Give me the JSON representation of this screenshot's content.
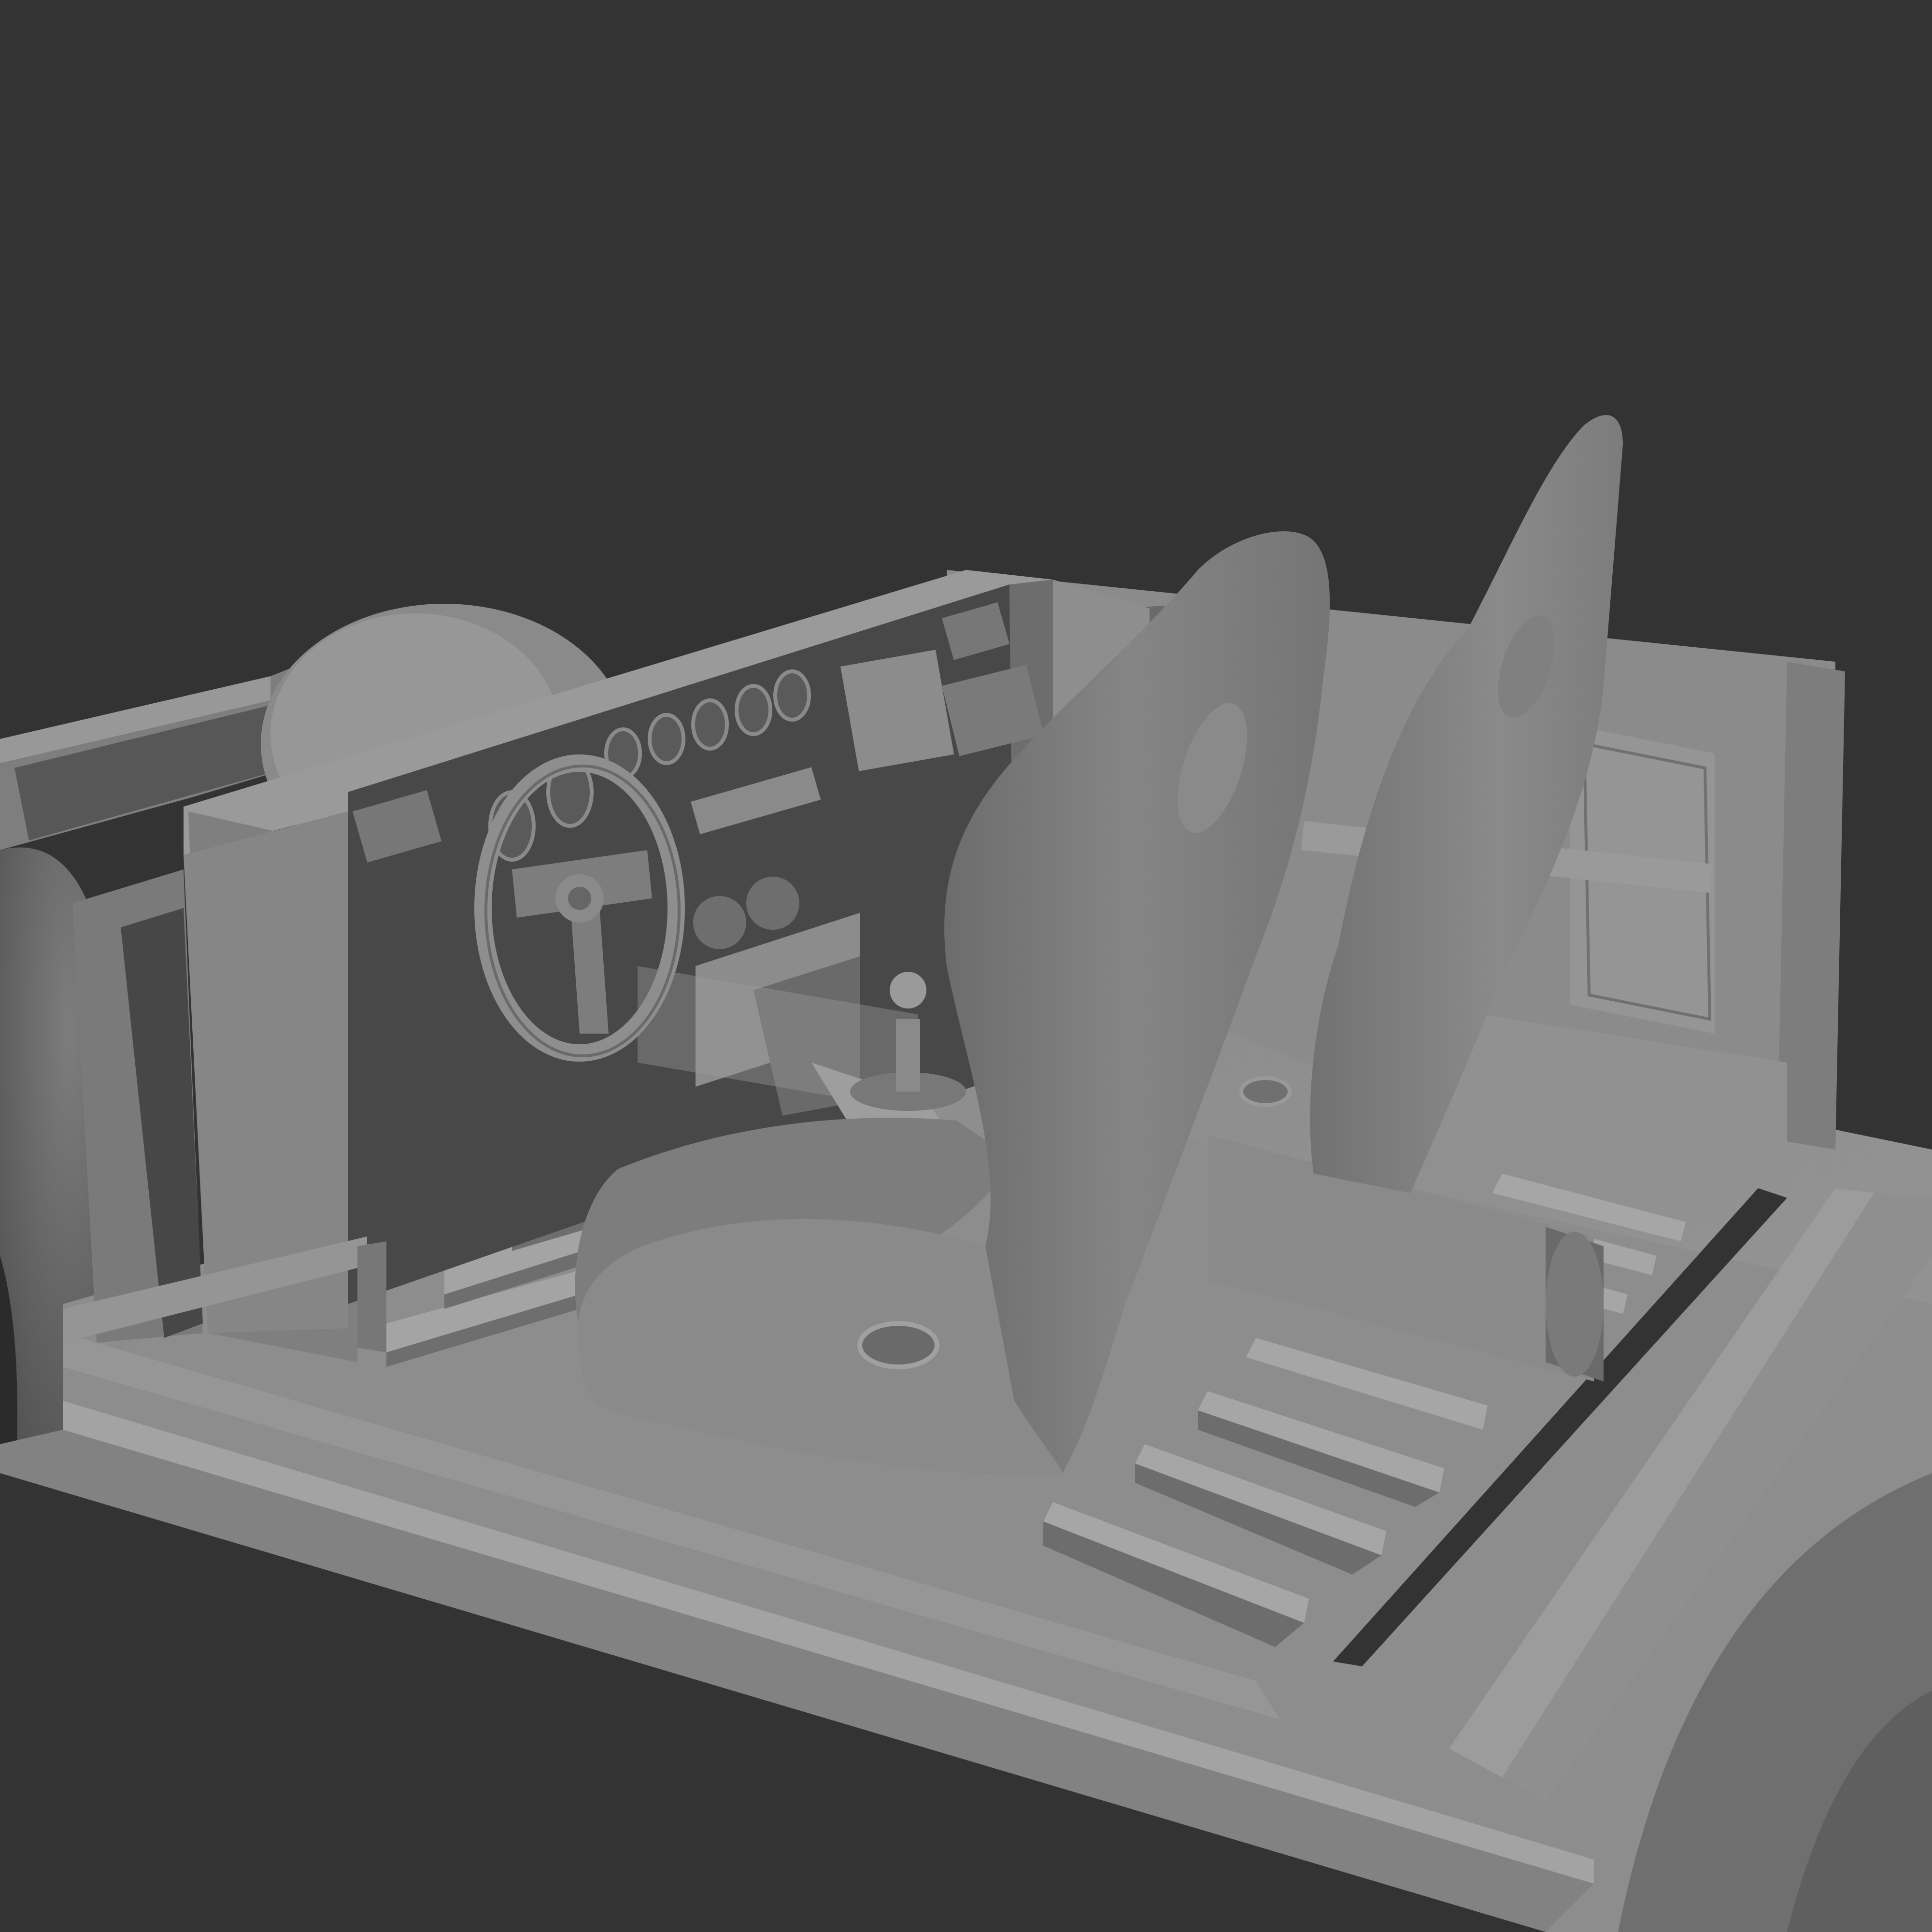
{
  "scene": {
    "subject": "car-interior-clay-render",
    "colors": {
      "background": "#333333",
      "clay": "#8c8c8c",
      "clay_light": "#9c9c9c",
      "clay_dark": "#5e5e5e",
      "panel": "#474747",
      "shadow": "#3a3a3a"
    },
    "objects": [
      {
        "name": "chassis-floor"
      },
      {
        "name": "dashboard"
      },
      {
        "name": "steering-wheel"
      },
      {
        "name": "gauge-cluster"
      },
      {
        "name": "center-console"
      },
      {
        "name": "gear-shifter"
      },
      {
        "name": "driver-seat"
      },
      {
        "name": "passenger-seat"
      },
      {
        "name": "rear-bulkhead"
      },
      {
        "name": "front-wheel-arch"
      },
      {
        "name": "rear-wheel-arch"
      }
    ]
  }
}
